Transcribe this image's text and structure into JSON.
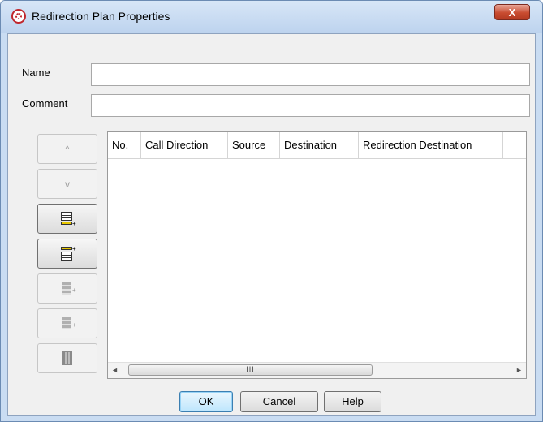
{
  "window": {
    "title": "Redirection Plan Properties",
    "close_label": "X",
    "app_icon": "globe-icon"
  },
  "form": {
    "name_label": "Name",
    "name_value": "",
    "comment_label": "Comment",
    "comment_value": ""
  },
  "side_buttons": [
    {
      "name": "move-up-button",
      "icon": "chevron-up-icon",
      "glyph": "^",
      "enabled": false
    },
    {
      "name": "move-down-button",
      "icon": "chevron-down-icon",
      "glyph": "v",
      "enabled": false
    },
    {
      "name": "insert-row-below-button",
      "icon": "table-insert-below-icon",
      "enabled": true
    },
    {
      "name": "insert-row-above-button",
      "icon": "table-insert-above-icon",
      "enabled": true
    },
    {
      "name": "edit-row-button",
      "icon": "row-edit-icon",
      "enabled": false
    },
    {
      "name": "copy-row-button",
      "icon": "row-copy-icon",
      "enabled": false
    },
    {
      "name": "delete-row-button",
      "icon": "trash-icon",
      "enabled": false
    }
  ],
  "table": {
    "columns": [
      "No.",
      "Call Direction",
      "Source",
      "Destination",
      "Redirection Destination"
    ],
    "rows": [],
    "scroll_thumb_text": "III"
  },
  "buttons": {
    "ok": "OK",
    "cancel": "Cancel",
    "help": "Help"
  }
}
